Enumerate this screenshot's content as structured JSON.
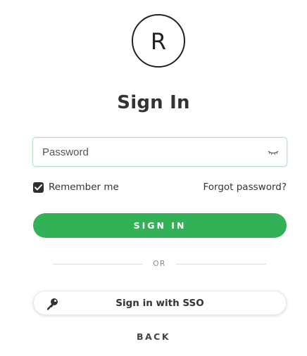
{
  "logo": {
    "letter": "R"
  },
  "title": "Sign In",
  "password": {
    "placeholder": "Password",
    "value": "",
    "toggle_icon": "eye-closed-icon"
  },
  "remember_me": {
    "label": "Remember me",
    "checked": true
  },
  "forgot_password": "Forgot password?",
  "sign_in_button": "SIGN IN",
  "divider": "OR",
  "sso_button": {
    "label": "Sign in with SSO",
    "icon": "key-icon"
  },
  "back": "BACK",
  "colors": {
    "primary": "#33b157",
    "input_border": "#b6e3c4",
    "text": "#333333"
  }
}
